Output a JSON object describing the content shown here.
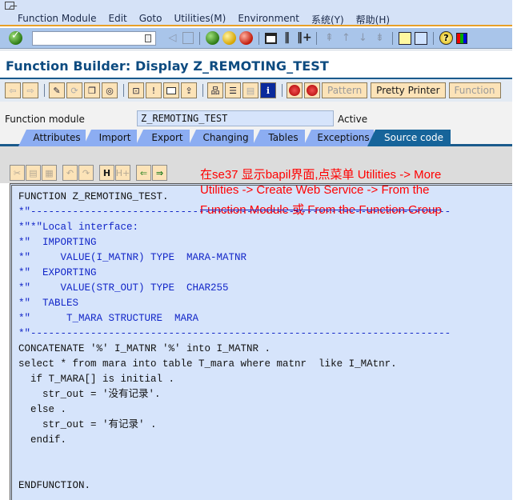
{
  "menubar": {
    "items": [
      "Function Module",
      "Edit",
      "Goto",
      "Utilities(M)",
      "Environment",
      "系统(Y)",
      "帮助(H)"
    ]
  },
  "system_toolbar": {
    "command_field_value": "",
    "icons": [
      "enter-icon",
      "command-dropdown-icon",
      "back-nav-icon",
      "save-icon",
      "back-icon",
      "exit-icon",
      "cancel-icon",
      "print-icon",
      "find-icon",
      "find-next-icon",
      "first-page-icon",
      "previous-page-icon",
      "next-page-icon",
      "last-page-icon",
      "create-session-icon",
      "create-shortcut-icon",
      "help-icon",
      "customize-layout-icon"
    ]
  },
  "title": "Function Builder: Display Z_REMOTING_TEST",
  "app_toolbar": {
    "buttons": [
      "Pattern",
      "Pretty Printer",
      "Function"
    ]
  },
  "function_module": {
    "label": "Function module",
    "value": "Z_REMOTING_TEST",
    "status": "Active"
  },
  "tabs": [
    {
      "label": "Attributes",
      "active": false
    },
    {
      "label": "Import",
      "active": false
    },
    {
      "label": "Export",
      "active": false
    },
    {
      "label": "Changing",
      "active": false
    },
    {
      "label": "Tables",
      "active": false
    },
    {
      "label": "Exceptions",
      "active": false
    },
    {
      "label": "Source code",
      "active": true
    }
  ],
  "annotation": {
    "line1": "在se37 显示bapil界面,点菜单 Utilities -> More",
    "line2": "Utilities -> Create Web Service -> From the",
    "line3": "Function Module 或 From the Function Group",
    "color": "#ff0000"
  },
  "code": {
    "lines": [
      {
        "text": "FUNCTION Z_REMOTING_TEST.",
        "type": "k"
      },
      {
        "text": "*\"----------------------------------------------------------------------",
        "type": "c"
      },
      {
        "text": "*\"*\"Local interface:",
        "type": "c"
      },
      {
        "text": "*\"  IMPORTING",
        "type": "c"
      },
      {
        "text": "*\"     VALUE(I_MATNR) TYPE  MARA-MATNR",
        "type": "c"
      },
      {
        "text": "*\"  EXPORTING",
        "type": "c"
      },
      {
        "text": "*\"     VALUE(STR_OUT) TYPE  CHAR255",
        "type": "c"
      },
      {
        "text": "*\"  TABLES",
        "type": "c"
      },
      {
        "text": "*\"      T_MARA STRUCTURE  MARA",
        "type": "c"
      },
      {
        "text": "*\"----------------------------------------------------------------------",
        "type": "c"
      },
      {
        "text": "CONCATENATE '%' I_MATNR '%' into I_MATNR .",
        "type": "k"
      },
      {
        "text": "select * from mara into table T_mara where matnr  like I_MAtnr.",
        "type": "k"
      },
      {
        "text": "  if T_MARA[] is initial .",
        "type": "k"
      },
      {
        "text": "    str_out = '没有记录'.",
        "type": "k"
      },
      {
        "text": "  else .",
        "type": "k"
      },
      {
        "text": "    str_out = '有记录' .",
        "type": "k"
      },
      {
        "text": "  endif.",
        "type": "k"
      },
      {
        "text": "",
        "type": "k"
      },
      {
        "text": "",
        "type": "k"
      },
      {
        "text": "ENDFUNCTION.",
        "type": "k"
      }
    ]
  }
}
